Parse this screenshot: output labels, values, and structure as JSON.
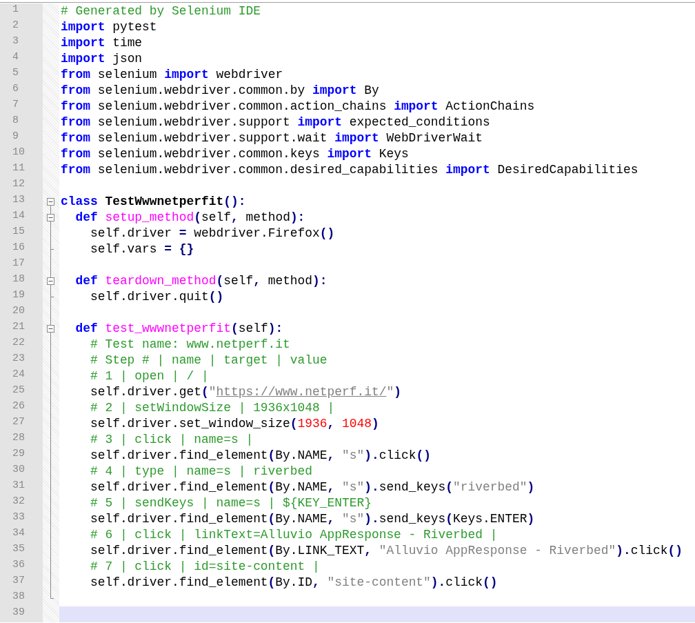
{
  "editor": {
    "lines": [
      {
        "number": "1",
        "kind": "plain",
        "current": false,
        "tokens": [
          {
            "kind": "comment",
            "text": "# Generated by Selenium IDE"
          }
        ]
      },
      {
        "number": "2",
        "kind": "plain",
        "current": false,
        "tokens": [
          {
            "kind": "keyword",
            "text": "import"
          },
          {
            "kind": "text",
            "text": " pytest"
          }
        ]
      },
      {
        "number": "3",
        "kind": "plain",
        "current": false,
        "tokens": [
          {
            "kind": "keyword",
            "text": "import"
          },
          {
            "kind": "text",
            "text": " time"
          }
        ]
      },
      {
        "number": "4",
        "kind": "plain",
        "current": false,
        "tokens": [
          {
            "kind": "keyword",
            "text": "import"
          },
          {
            "kind": "text",
            "text": " json"
          }
        ]
      },
      {
        "number": "5",
        "kind": "plain",
        "current": false,
        "tokens": [
          {
            "kind": "keyword",
            "text": "from"
          },
          {
            "kind": "text",
            "text": " selenium "
          },
          {
            "kind": "keyword",
            "text": "import"
          },
          {
            "kind": "text",
            "text": " webdriver"
          }
        ]
      },
      {
        "number": "6",
        "kind": "plain",
        "current": false,
        "tokens": [
          {
            "kind": "keyword",
            "text": "from"
          },
          {
            "kind": "text",
            "text": " selenium.webdriver.common.by "
          },
          {
            "kind": "keyword",
            "text": "import"
          },
          {
            "kind": "text",
            "text": " By"
          }
        ]
      },
      {
        "number": "7",
        "kind": "plain",
        "current": false,
        "tokens": [
          {
            "kind": "keyword",
            "text": "from"
          },
          {
            "kind": "text",
            "text": " selenium.webdriver.common.action_chains "
          },
          {
            "kind": "keyword",
            "text": "import"
          },
          {
            "kind": "text",
            "text": " ActionChains"
          }
        ]
      },
      {
        "number": "8",
        "kind": "plain",
        "current": false,
        "tokens": [
          {
            "kind": "keyword",
            "text": "from"
          },
          {
            "kind": "text",
            "text": " selenium.webdriver.support "
          },
          {
            "kind": "keyword",
            "text": "import"
          },
          {
            "kind": "text",
            "text": " expected_conditions"
          }
        ]
      },
      {
        "number": "9",
        "kind": "plain",
        "current": false,
        "tokens": [
          {
            "kind": "keyword",
            "text": "from"
          },
          {
            "kind": "text",
            "text": " selenium.webdriver.support.wait "
          },
          {
            "kind": "keyword",
            "text": "import"
          },
          {
            "kind": "text",
            "text": " WebDriverWait"
          }
        ]
      },
      {
        "number": "10",
        "kind": "plain",
        "current": false,
        "tokens": [
          {
            "kind": "keyword",
            "text": "from"
          },
          {
            "kind": "text",
            "text": " selenium.webdriver.common.keys "
          },
          {
            "kind": "keyword",
            "text": "import"
          },
          {
            "kind": "text",
            "text": " Keys"
          }
        ]
      },
      {
        "number": "11",
        "kind": "plain",
        "current": false,
        "tokens": [
          {
            "kind": "keyword",
            "text": "from"
          },
          {
            "kind": "text",
            "text": " selenium.webdriver.common.desired_capabilities "
          },
          {
            "kind": "keyword",
            "text": "import"
          },
          {
            "kind": "text",
            "text": " DesiredCapabilities"
          }
        ]
      },
      {
        "number": "12",
        "kind": "plain",
        "current": false
      },
      {
        "number": "13",
        "kind": "foldtop",
        "current": false,
        "tokens": [
          {
            "kind": "keyword",
            "text": "class"
          },
          {
            "kind": "classname",
            "text": " TestWwwnetperfit"
          },
          {
            "kind": "op",
            "text": "():"
          }
        ]
      },
      {
        "number": "14",
        "kind": "foldstart",
        "current": false,
        "tokens": [
          {
            "kind": "keyword",
            "text": "  def"
          },
          {
            "kind": "defname",
            "text": " setup_method"
          },
          {
            "kind": "op",
            "text": "("
          },
          {
            "kind": "text",
            "text": "self"
          },
          {
            "kind": "op",
            "text": ", "
          },
          {
            "kind": "text",
            "text": "method"
          },
          {
            "kind": "op",
            "text": "):"
          }
        ]
      },
      {
        "number": "15",
        "kind": "foldbody",
        "current": false,
        "tokens": [
          {
            "kind": "text",
            "text": "    self.driver "
          },
          {
            "kind": "op",
            "text": "="
          },
          {
            "kind": "text",
            "text": " webdriver.Firefox"
          },
          {
            "kind": "op",
            "text": "()"
          }
        ]
      },
      {
        "number": "16",
        "kind": "foldend",
        "current": false,
        "tokens": [
          {
            "kind": "text",
            "text": "    self.vars "
          },
          {
            "kind": "op",
            "text": "= {}"
          }
        ]
      },
      {
        "number": "17",
        "kind": "foldbody",
        "current": false
      },
      {
        "number": "18",
        "kind": "foldstart",
        "current": false,
        "tokens": [
          {
            "kind": "keyword",
            "text": "  def"
          },
          {
            "kind": "defname",
            "text": " teardown_method"
          },
          {
            "kind": "op",
            "text": "("
          },
          {
            "kind": "text",
            "text": "self"
          },
          {
            "kind": "op",
            "text": ", "
          },
          {
            "kind": "text",
            "text": "method"
          },
          {
            "kind": "op",
            "text": "):"
          }
        ]
      },
      {
        "number": "19",
        "kind": "foldend",
        "current": false,
        "tokens": [
          {
            "kind": "text",
            "text": "    self.driver.quit"
          },
          {
            "kind": "op",
            "text": "()"
          }
        ]
      },
      {
        "number": "20",
        "kind": "foldbody",
        "current": false
      },
      {
        "number": "21",
        "kind": "foldstart",
        "current": false,
        "tokens": [
          {
            "kind": "keyword",
            "text": "  def"
          },
          {
            "kind": "defname",
            "text": " test_wwwnetperfit"
          },
          {
            "kind": "op",
            "text": "("
          },
          {
            "kind": "text",
            "text": "self"
          },
          {
            "kind": "op",
            "text": "):"
          }
        ]
      },
      {
        "number": "22",
        "kind": "foldbody",
        "current": false,
        "tokens": [
          {
            "kind": "comment",
            "text": "    # Test name: www.netperf.it"
          }
        ]
      },
      {
        "number": "23",
        "kind": "foldbody",
        "current": false,
        "tokens": [
          {
            "kind": "comment",
            "text": "    # Step # | name | target | value"
          }
        ]
      },
      {
        "number": "24",
        "kind": "foldbody",
        "current": false,
        "tokens": [
          {
            "kind": "comment",
            "text": "    # 1 | open | / |"
          }
        ]
      },
      {
        "number": "25",
        "kind": "foldbody",
        "current": false,
        "tokens": [
          {
            "kind": "text",
            "text": "    self.driver.get"
          },
          {
            "kind": "op",
            "text": "("
          },
          {
            "kind": "string",
            "text": "\""
          },
          {
            "kind": "link",
            "text": "https://www.netperf.it/"
          },
          {
            "kind": "string",
            "text": "\""
          },
          {
            "kind": "op",
            "text": ")"
          }
        ]
      },
      {
        "number": "26",
        "kind": "foldbody",
        "current": false,
        "tokens": [
          {
            "kind": "comment",
            "text": "    # 2 | setWindowSize | 1936x1048 |"
          }
        ]
      },
      {
        "number": "27",
        "kind": "foldbody",
        "current": false,
        "tokens": [
          {
            "kind": "text",
            "text": "    self.driver.set_window_size"
          },
          {
            "kind": "op",
            "text": "("
          },
          {
            "kind": "number",
            "text": "1936"
          },
          {
            "kind": "op",
            "text": ", "
          },
          {
            "kind": "number",
            "text": "1048"
          },
          {
            "kind": "op",
            "text": ")"
          }
        ]
      },
      {
        "number": "28",
        "kind": "foldbody",
        "current": false,
        "tokens": [
          {
            "kind": "comment",
            "text": "    # 3 | click | name=s |"
          }
        ]
      },
      {
        "number": "29",
        "kind": "foldbody",
        "current": false,
        "tokens": [
          {
            "kind": "text",
            "text": "    self.driver.find_element"
          },
          {
            "kind": "op",
            "text": "("
          },
          {
            "kind": "text",
            "text": "By.NAME"
          },
          {
            "kind": "op",
            "text": ", "
          },
          {
            "kind": "string",
            "text": "\"s\""
          },
          {
            "kind": "op",
            "text": ")."
          },
          {
            "kind": "text",
            "text": "click"
          },
          {
            "kind": "op",
            "text": "()"
          }
        ]
      },
      {
        "number": "30",
        "kind": "foldbody",
        "current": false,
        "tokens": [
          {
            "kind": "comment",
            "text": "    # 4 | type | name=s | riverbed"
          }
        ]
      },
      {
        "number": "31",
        "kind": "foldbody",
        "current": false,
        "tokens": [
          {
            "kind": "text",
            "text": "    self.driver.find_element"
          },
          {
            "kind": "op",
            "text": "("
          },
          {
            "kind": "text",
            "text": "By.NAME"
          },
          {
            "kind": "op",
            "text": ", "
          },
          {
            "kind": "string",
            "text": "\"s\""
          },
          {
            "kind": "op",
            "text": ")."
          },
          {
            "kind": "text",
            "text": "send_keys"
          },
          {
            "kind": "op",
            "text": "("
          },
          {
            "kind": "string",
            "text": "\"riverbed\""
          },
          {
            "kind": "op",
            "text": ")"
          }
        ]
      },
      {
        "number": "32",
        "kind": "foldbody",
        "current": false,
        "tokens": [
          {
            "kind": "comment",
            "text": "    # 5 | sendKeys | name=s | ${KEY_ENTER}"
          }
        ]
      },
      {
        "number": "33",
        "kind": "foldbody",
        "current": false,
        "tokens": [
          {
            "kind": "text",
            "text": "    self.driver.find_element"
          },
          {
            "kind": "op",
            "text": "("
          },
          {
            "kind": "text",
            "text": "By.NAME"
          },
          {
            "kind": "op",
            "text": ", "
          },
          {
            "kind": "string",
            "text": "\"s\""
          },
          {
            "kind": "op",
            "text": ")."
          },
          {
            "kind": "text",
            "text": "send_keys"
          },
          {
            "kind": "op",
            "text": "("
          },
          {
            "kind": "text",
            "text": "Keys.ENTER"
          },
          {
            "kind": "op",
            "text": ")"
          }
        ]
      },
      {
        "number": "34",
        "kind": "foldbody",
        "current": false,
        "tokens": [
          {
            "kind": "comment",
            "text": "    # 6 | click | linkText=Alluvio AppResponse - Riverbed |"
          }
        ]
      },
      {
        "number": "35",
        "kind": "foldbody",
        "current": false,
        "tokens": [
          {
            "kind": "text",
            "text": "    self.driver.find_element"
          },
          {
            "kind": "op",
            "text": "("
          },
          {
            "kind": "text",
            "text": "By.LINK_TEXT"
          },
          {
            "kind": "op",
            "text": ", "
          },
          {
            "kind": "string",
            "text": "\"Alluvio AppResponse - Riverbed\""
          },
          {
            "kind": "op",
            "text": ")."
          },
          {
            "kind": "text",
            "text": "click"
          },
          {
            "kind": "op",
            "text": "()"
          }
        ]
      },
      {
        "number": "36",
        "kind": "foldbody",
        "current": false,
        "tokens": [
          {
            "kind": "comment",
            "text": "    # 7 | click | id=site-content |"
          }
        ]
      },
      {
        "number": "37",
        "kind": "foldbody",
        "current": false,
        "tokens": [
          {
            "kind": "text",
            "text": "    self.driver.find_element"
          },
          {
            "kind": "op",
            "text": "("
          },
          {
            "kind": "text",
            "text": "By.ID"
          },
          {
            "kind": "op",
            "text": ", "
          },
          {
            "kind": "string",
            "text": "\"site-content\""
          },
          {
            "kind": "op",
            "text": ")."
          },
          {
            "kind": "text",
            "text": "click"
          },
          {
            "kind": "op",
            "text": "()"
          }
        ]
      },
      {
        "number": "38",
        "kind": "foldlast",
        "current": false
      },
      {
        "number": "39",
        "kind": "plain",
        "current": true
      }
    ]
  }
}
